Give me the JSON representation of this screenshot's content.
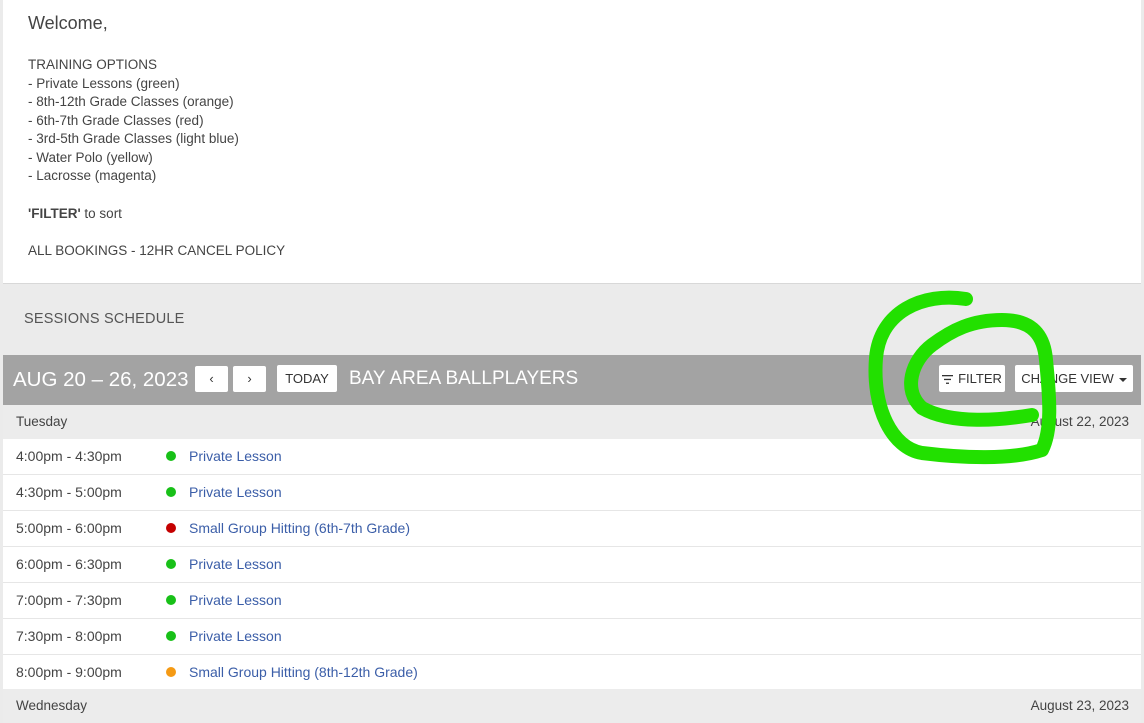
{
  "welcome": {
    "title": "Welcome,",
    "options_heading": "TRAINING OPTIONS",
    "options": [
      "- Private Lessons (green)",
      "- 8th-12th Grade Classes (orange)",
      "- 6th-7th Grade Classes (red)",
      "- 3rd-5th Grade Classes (light blue)",
      "- Water Polo (yellow)",
      "- Lacrosse (magenta)"
    ],
    "filter_keyword": "'FILTER'",
    "filter_rest": " to sort",
    "cancel_policy": "ALL BOOKINGS - 12HR CANCEL POLICY"
  },
  "schedule": {
    "section_title": "SESSIONS SCHEDULE",
    "date_range": "AUG 20 – 26, 2023",
    "prev_label": "‹",
    "next_label": "›",
    "today_label": "TODAY",
    "org_name": "BAY AREA BALLPLAYERS",
    "filter_label": "FILTER",
    "change_view_label": "CHANGE VIEW",
    "days": [
      {
        "name": "Tuesday",
        "date": "August 22, 2023",
        "sessions": [
          {
            "time": "4:00pm - 4:30pm",
            "title": "Private Lesson",
            "color": "#18c018"
          },
          {
            "time": "4:30pm - 5:00pm",
            "title": "Private Lesson",
            "color": "#18c018"
          },
          {
            "time": "5:00pm - 6:00pm",
            "title": "Small Group Hitting (6th-7th Grade)",
            "color": "#c40000"
          },
          {
            "time": "6:00pm - 6:30pm",
            "title": "Private Lesson",
            "color": "#18c018"
          },
          {
            "time": "7:00pm - 7:30pm",
            "title": "Private Lesson",
            "color": "#18c018"
          },
          {
            "time": "7:30pm - 8:00pm",
            "title": "Private Lesson",
            "color": "#18c018"
          },
          {
            "time": "8:00pm - 9:00pm",
            "title": "Small Group Hitting (8th-12th Grade)",
            "color": "#f59a14"
          }
        ]
      },
      {
        "name": "Wednesday",
        "date": "August 23, 2023"
      }
    ]
  },
  "colors": {
    "toolbar_bg": "#a3a3a3",
    "link": "#3b5ea8",
    "annotation": "#22e000"
  }
}
